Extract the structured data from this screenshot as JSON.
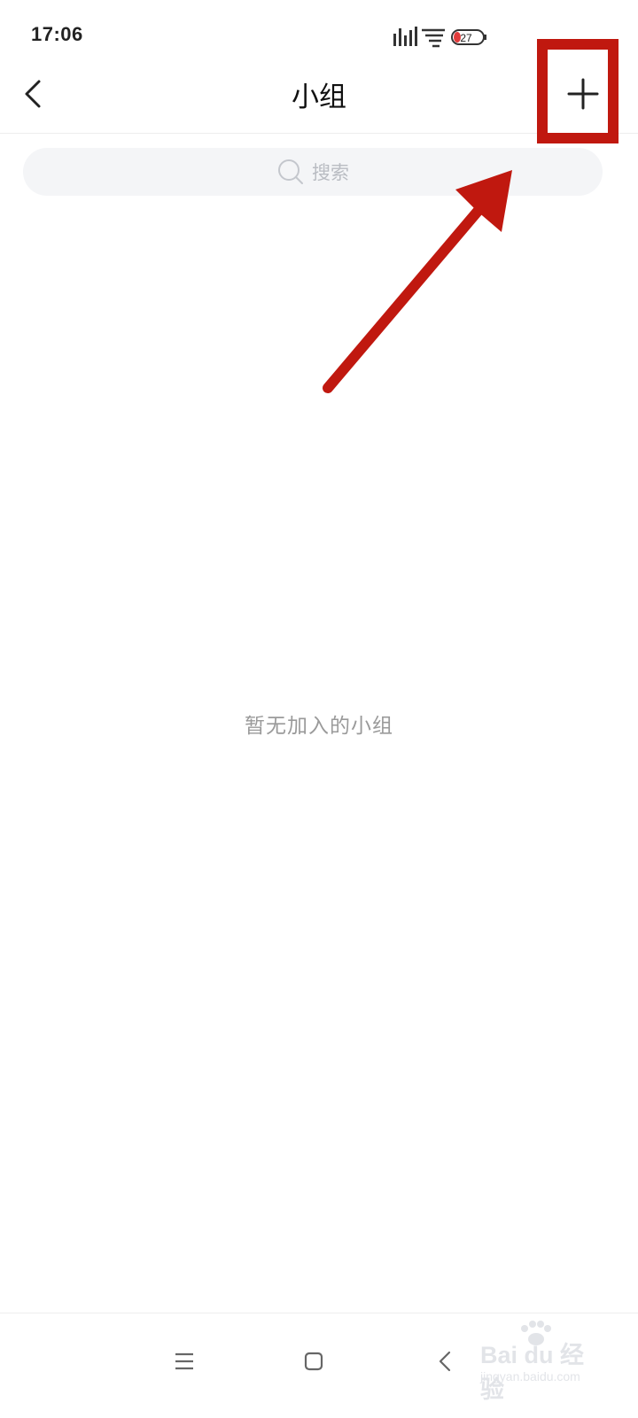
{
  "status_bar": {
    "time": "17:06",
    "battery_level": "27",
    "icons": [
      "signal-icon",
      "wifi-icon",
      "battery-icon"
    ]
  },
  "header": {
    "title": "小组",
    "back_icon": "chevron-left-icon",
    "add_icon": "plus-icon"
  },
  "search": {
    "placeholder": "搜索",
    "icon": "search-icon"
  },
  "main": {
    "empty_message": "暂无加入的小组"
  },
  "navigation_bar": {
    "icons": [
      "menu-icon",
      "home-icon",
      "back-icon"
    ]
  },
  "annotation": {
    "color": "#c0180f",
    "highlight_target": "add-button",
    "arrow_points_to": "add-button"
  },
  "watermark": {
    "brand": "Bai du 经验",
    "url": "jingyan.baidu.com"
  },
  "colors": {
    "background": "#ffffff",
    "search_background": "#f4f5f7",
    "placeholder": "#b9bcc2",
    "empty_text": "#9a9a9a",
    "annotation_red": "#c0180f"
  }
}
